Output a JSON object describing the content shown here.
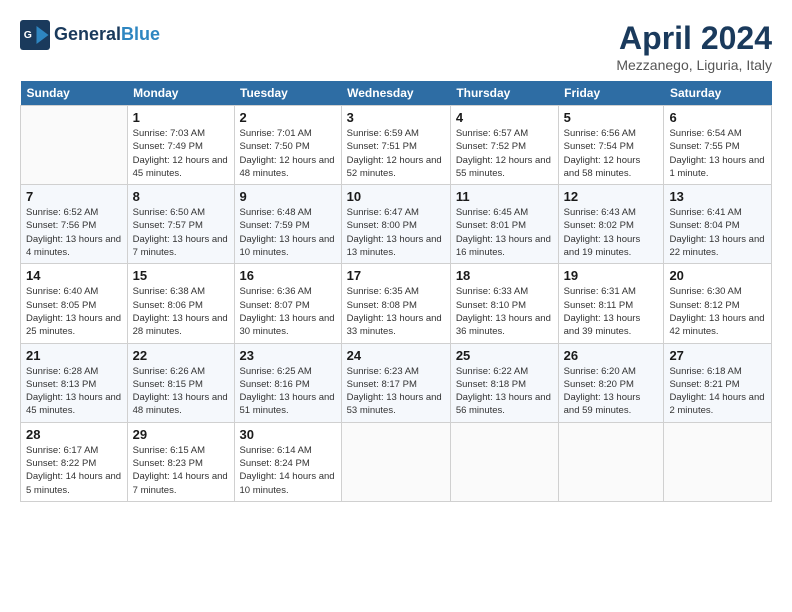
{
  "logo": {
    "line1": "General",
    "line2": "Blue"
  },
  "title": "April 2024",
  "location": "Mezzanego, Liguria, Italy",
  "weekdays": [
    "Sunday",
    "Monday",
    "Tuesday",
    "Wednesday",
    "Thursday",
    "Friday",
    "Saturday"
  ],
  "weeks": [
    [
      {
        "day": "",
        "sunrise": "",
        "sunset": "",
        "daylight": ""
      },
      {
        "day": "1",
        "sunrise": "Sunrise: 7:03 AM",
        "sunset": "Sunset: 7:49 PM",
        "daylight": "Daylight: 12 hours and 45 minutes."
      },
      {
        "day": "2",
        "sunrise": "Sunrise: 7:01 AM",
        "sunset": "Sunset: 7:50 PM",
        "daylight": "Daylight: 12 hours and 48 minutes."
      },
      {
        "day": "3",
        "sunrise": "Sunrise: 6:59 AM",
        "sunset": "Sunset: 7:51 PM",
        "daylight": "Daylight: 12 hours and 52 minutes."
      },
      {
        "day": "4",
        "sunrise": "Sunrise: 6:57 AM",
        "sunset": "Sunset: 7:52 PM",
        "daylight": "Daylight: 12 hours and 55 minutes."
      },
      {
        "day": "5",
        "sunrise": "Sunrise: 6:56 AM",
        "sunset": "Sunset: 7:54 PM",
        "daylight": "Daylight: 12 hours and 58 minutes."
      },
      {
        "day": "6",
        "sunrise": "Sunrise: 6:54 AM",
        "sunset": "Sunset: 7:55 PM",
        "daylight": "Daylight: 13 hours and 1 minute."
      }
    ],
    [
      {
        "day": "7",
        "sunrise": "Sunrise: 6:52 AM",
        "sunset": "Sunset: 7:56 PM",
        "daylight": "Daylight: 13 hours and 4 minutes."
      },
      {
        "day": "8",
        "sunrise": "Sunrise: 6:50 AM",
        "sunset": "Sunset: 7:57 PM",
        "daylight": "Daylight: 13 hours and 7 minutes."
      },
      {
        "day": "9",
        "sunrise": "Sunrise: 6:48 AM",
        "sunset": "Sunset: 7:59 PM",
        "daylight": "Daylight: 13 hours and 10 minutes."
      },
      {
        "day": "10",
        "sunrise": "Sunrise: 6:47 AM",
        "sunset": "Sunset: 8:00 PM",
        "daylight": "Daylight: 13 hours and 13 minutes."
      },
      {
        "day": "11",
        "sunrise": "Sunrise: 6:45 AM",
        "sunset": "Sunset: 8:01 PM",
        "daylight": "Daylight: 13 hours and 16 minutes."
      },
      {
        "day": "12",
        "sunrise": "Sunrise: 6:43 AM",
        "sunset": "Sunset: 8:02 PM",
        "daylight": "Daylight: 13 hours and 19 minutes."
      },
      {
        "day": "13",
        "sunrise": "Sunrise: 6:41 AM",
        "sunset": "Sunset: 8:04 PM",
        "daylight": "Daylight: 13 hours and 22 minutes."
      }
    ],
    [
      {
        "day": "14",
        "sunrise": "Sunrise: 6:40 AM",
        "sunset": "Sunset: 8:05 PM",
        "daylight": "Daylight: 13 hours and 25 minutes."
      },
      {
        "day": "15",
        "sunrise": "Sunrise: 6:38 AM",
        "sunset": "Sunset: 8:06 PM",
        "daylight": "Daylight: 13 hours and 28 minutes."
      },
      {
        "day": "16",
        "sunrise": "Sunrise: 6:36 AM",
        "sunset": "Sunset: 8:07 PM",
        "daylight": "Daylight: 13 hours and 30 minutes."
      },
      {
        "day": "17",
        "sunrise": "Sunrise: 6:35 AM",
        "sunset": "Sunset: 8:08 PM",
        "daylight": "Daylight: 13 hours and 33 minutes."
      },
      {
        "day": "18",
        "sunrise": "Sunrise: 6:33 AM",
        "sunset": "Sunset: 8:10 PM",
        "daylight": "Daylight: 13 hours and 36 minutes."
      },
      {
        "day": "19",
        "sunrise": "Sunrise: 6:31 AM",
        "sunset": "Sunset: 8:11 PM",
        "daylight": "Daylight: 13 hours and 39 minutes."
      },
      {
        "day": "20",
        "sunrise": "Sunrise: 6:30 AM",
        "sunset": "Sunset: 8:12 PM",
        "daylight": "Daylight: 13 hours and 42 minutes."
      }
    ],
    [
      {
        "day": "21",
        "sunrise": "Sunrise: 6:28 AM",
        "sunset": "Sunset: 8:13 PM",
        "daylight": "Daylight: 13 hours and 45 minutes."
      },
      {
        "day": "22",
        "sunrise": "Sunrise: 6:26 AM",
        "sunset": "Sunset: 8:15 PM",
        "daylight": "Daylight: 13 hours and 48 minutes."
      },
      {
        "day": "23",
        "sunrise": "Sunrise: 6:25 AM",
        "sunset": "Sunset: 8:16 PM",
        "daylight": "Daylight: 13 hours and 51 minutes."
      },
      {
        "day": "24",
        "sunrise": "Sunrise: 6:23 AM",
        "sunset": "Sunset: 8:17 PM",
        "daylight": "Daylight: 13 hours and 53 minutes."
      },
      {
        "day": "25",
        "sunrise": "Sunrise: 6:22 AM",
        "sunset": "Sunset: 8:18 PM",
        "daylight": "Daylight: 13 hours and 56 minutes."
      },
      {
        "day": "26",
        "sunrise": "Sunrise: 6:20 AM",
        "sunset": "Sunset: 8:20 PM",
        "daylight": "Daylight: 13 hours and 59 minutes."
      },
      {
        "day": "27",
        "sunrise": "Sunrise: 6:18 AM",
        "sunset": "Sunset: 8:21 PM",
        "daylight": "Daylight: 14 hours and 2 minutes."
      }
    ],
    [
      {
        "day": "28",
        "sunrise": "Sunrise: 6:17 AM",
        "sunset": "Sunset: 8:22 PM",
        "daylight": "Daylight: 14 hours and 5 minutes."
      },
      {
        "day": "29",
        "sunrise": "Sunrise: 6:15 AM",
        "sunset": "Sunset: 8:23 PM",
        "daylight": "Daylight: 14 hours and 7 minutes."
      },
      {
        "day": "30",
        "sunrise": "Sunrise: 6:14 AM",
        "sunset": "Sunset: 8:24 PM",
        "daylight": "Daylight: 14 hours and 10 minutes."
      },
      {
        "day": "",
        "sunrise": "",
        "sunset": "",
        "daylight": ""
      },
      {
        "day": "",
        "sunrise": "",
        "sunset": "",
        "daylight": ""
      },
      {
        "day": "",
        "sunrise": "",
        "sunset": "",
        "daylight": ""
      },
      {
        "day": "",
        "sunrise": "",
        "sunset": "",
        "daylight": ""
      }
    ]
  ]
}
